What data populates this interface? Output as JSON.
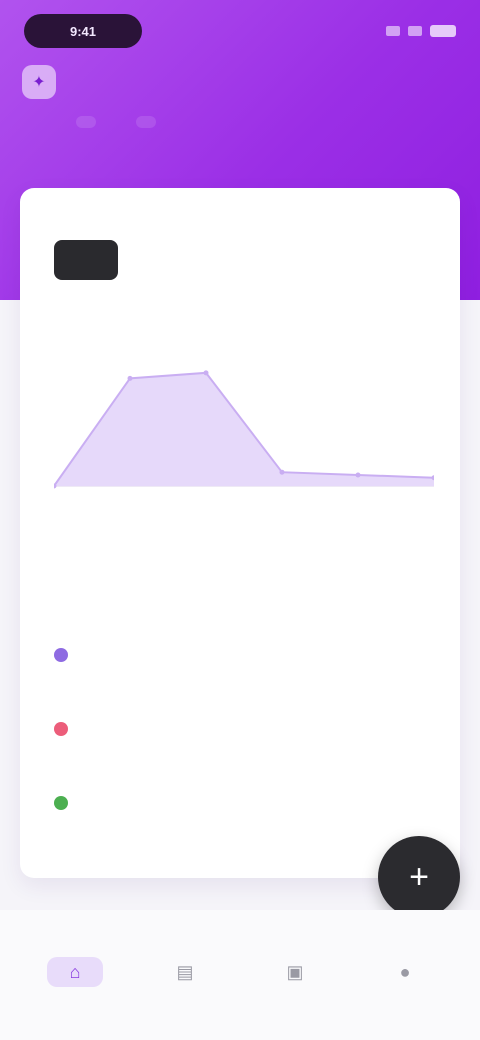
{
  "status": {
    "time": "9:41"
  },
  "header": {
    "avatar_glyph": "✦",
    "title": ""
  },
  "hero_tabs": [
    "",
    ""
  ],
  "metric": {
    "value": ""
  },
  "chart_data": {
    "type": "area",
    "x": [
      0,
      1,
      2,
      3,
      4,
      5
    ],
    "values": [
      0,
      78,
      82,
      10,
      8,
      6
    ],
    "ylim": [
      0,
      100
    ],
    "colors": {
      "fill": "#e6d9fa",
      "stroke": "#c9aef2"
    }
  },
  "section": {
    "title": ""
  },
  "list": [
    {
      "label": "",
      "value": "",
      "color": "#8e6be2"
    },
    {
      "label": "",
      "value": "",
      "color": "#ec5d7a"
    },
    {
      "label": "",
      "value": "",
      "color": "#4caf50"
    }
  ],
  "fab": {
    "glyph": "+"
  },
  "nav": [
    {
      "icon": "home-icon",
      "glyph": "⌂",
      "label": ""
    },
    {
      "icon": "chart-icon",
      "glyph": "▤",
      "label": ""
    },
    {
      "icon": "wallet-icon",
      "glyph": "▣",
      "label": ""
    },
    {
      "icon": "profile-icon",
      "glyph": "●",
      "label": ""
    }
  ],
  "colors": {
    "accent": "#9b2fe6"
  }
}
